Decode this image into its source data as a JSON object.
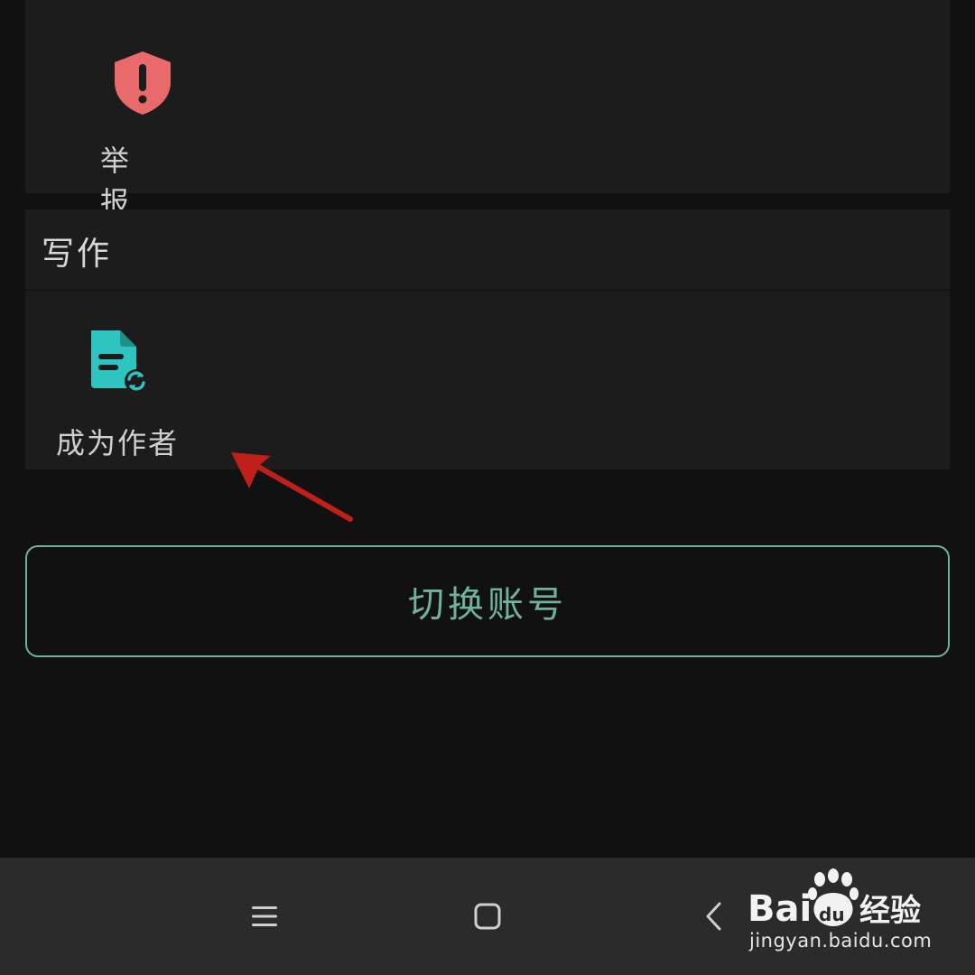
{
  "menu": {
    "report": {
      "label": "举报",
      "icon": "shield-warning-icon",
      "icon_color": "#e86a6a"
    }
  },
  "writing_section": {
    "title": "写作",
    "items": [
      {
        "label": "成为作者",
        "icon": "document-refresh-icon",
        "icon_color": "#2ec4c0"
      }
    ]
  },
  "switch_account": {
    "label": "切换账号",
    "color": "#6fb39a"
  },
  "nav_bar": {
    "menu_icon": "hamburger-icon",
    "home_icon": "square-home-icon",
    "back_icon": "chevron-left-icon"
  },
  "watermark": {
    "brand": "Bai du 经验",
    "url": "jingyan.baidu.com"
  },
  "annotation": {
    "type": "arrow",
    "color": "#c0201a"
  }
}
